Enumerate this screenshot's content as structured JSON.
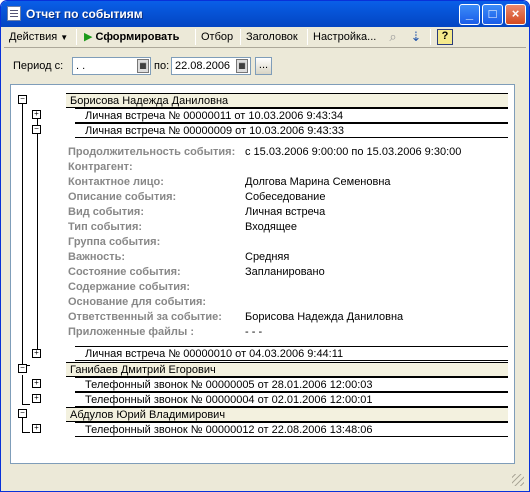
{
  "window": {
    "title": "Отчет по событиям"
  },
  "toolbar": {
    "actions_label": "Действия",
    "generate_label": "Сформировать",
    "filter_label": "Отбор",
    "header_label": "Заголовок",
    "settings_label": "Настройка...",
    "help_label": "?"
  },
  "period": {
    "from_label": "Период с:",
    "from_value": "  .  .",
    "to_label": "по:",
    "to_value": "22.08.2006",
    "select_label": "..."
  },
  "report": {
    "groups": [
      {
        "name": "Борисова Надежда Даниловна"
      },
      {
        "name": "Ганибаев Дмитрий Егорович"
      },
      {
        "name": "Абдулов Юрий Владимирович"
      }
    ],
    "rows": [
      "Личная встреча № 00000011 от 10.03.2006 9:43:34",
      "Личная встреча № 00000009 от 10.03.2006 9:43:33",
      "Личная встреча № 00000010 от 04.03.2006 9:44:11",
      "Телефонный звонок № 00000005 от 28.01.2006 12:00:03",
      "Телефонный звонок № 00000004 от 02.01.2006 12:00:01",
      "Телефонный звонок № 00000012 от 22.08.2006 13:48:06"
    ],
    "details": [
      {
        "label": "Продолжительность события:",
        "value": "с 15.03.2006 9:00:00 по 15.03.2006 9:30:00"
      },
      {
        "label": "Контрагент:",
        "value": ""
      },
      {
        "label": "Контактное лицо:",
        "value": "Долгова Марина Семеновна"
      },
      {
        "label": "Описание события:",
        "value": "Собеседование"
      },
      {
        "label": "Вид события:",
        "value": "Личная встреча"
      },
      {
        "label": "Тип события:",
        "value": "Входящее"
      },
      {
        "label": "Группа события:",
        "value": ""
      },
      {
        "label": "Важность:",
        "value": "Средняя"
      },
      {
        "label": "Состояние события:",
        "value": "Запланировано"
      },
      {
        "label": "Содержание события:",
        "value": ""
      },
      {
        "label": "Основание для события:",
        "value": ""
      },
      {
        "label": "Ответственный за событие:",
        "value": "Борисова Надежда Даниловна"
      },
      {
        "label": "Приложенные файлы :",
        "value": "- - -"
      }
    ]
  }
}
